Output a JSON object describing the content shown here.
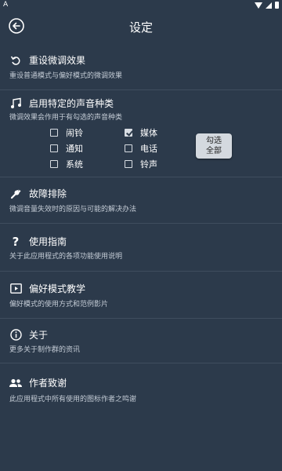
{
  "statusbar": {
    "left_text": "A"
  },
  "header": {
    "title": "设定",
    "back_icon": "arrow-left-circle-icon"
  },
  "items": [
    {
      "title": "重设微调效果",
      "desc": "重设普通模式与偏好模式的微调效果",
      "icon": "reset-icon"
    },
    {
      "title": "启用特定的声音种类",
      "desc": "微调效果会作用于有勾选的声音种类",
      "icon": "music-notes-icon"
    },
    {
      "title": "故障排除",
      "desc": "微调音量失效时的原因与可能的解决办法",
      "icon": "wrench-icon"
    },
    {
      "title": "使用指南",
      "desc": "关于此应用程式的各项功能使用说明",
      "icon": "question-icon"
    },
    {
      "title": "偏好模式教学",
      "desc": "偏好模式的使用方式和范例影片",
      "icon": "video-play-icon"
    },
    {
      "title": "关于",
      "desc": "更多关于制作群的资讯",
      "icon": "info-icon"
    },
    {
      "title": "作者致谢",
      "desc": "此应用程式中所有使用的图标作者之鸣谢",
      "icon": "people-icon"
    }
  ],
  "sound_types": [
    {
      "label": "闹铃",
      "checked": false
    },
    {
      "label": "媒体",
      "checked": true
    },
    {
      "label": "通知",
      "checked": false
    },
    {
      "label": "电话",
      "checked": false
    },
    {
      "label": "系统",
      "checked": false
    },
    {
      "label": "铃声",
      "checked": false
    }
  ],
  "select_all": {
    "line1": "勾选",
    "line2": "全部"
  }
}
